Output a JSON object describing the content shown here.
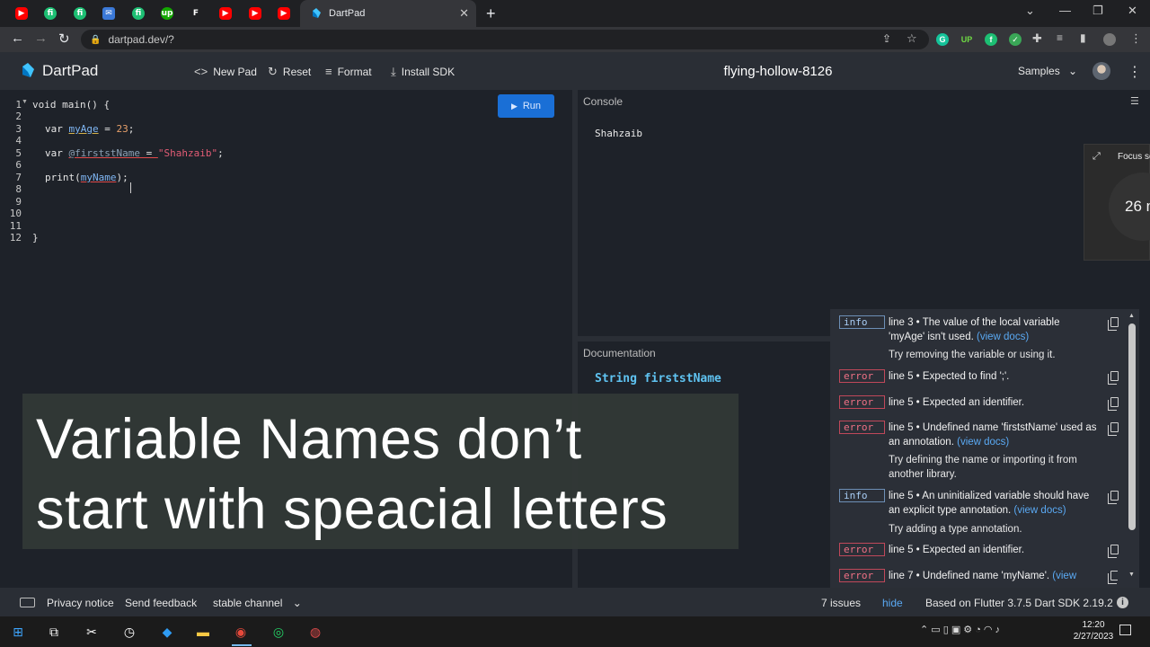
{
  "browser": {
    "active_tab_title": "DartPad",
    "url": "dartpad.dev/?",
    "pinned_tabs": [
      {
        "icon": "youtube-icon",
        "glyph": "▶"
      },
      {
        "icon": "fiverr-icon",
        "glyph": "fi"
      },
      {
        "icon": "fiverr-icon",
        "glyph": "fi"
      },
      {
        "icon": "gmail-icon",
        "glyph": "✉"
      },
      {
        "icon": "fiverr-icon",
        "glyph": "fi"
      },
      {
        "icon": "upwork-icon",
        "glyph": "up"
      },
      {
        "icon": "figma-icon",
        "glyph": "F"
      },
      {
        "icon": "youtube-icon",
        "glyph": "▶"
      },
      {
        "icon": "youtube-icon",
        "glyph": "▶"
      },
      {
        "icon": "youtube-icon",
        "glyph": "▶"
      }
    ]
  },
  "header": {
    "brand": "DartPad",
    "new_pad": "New Pad",
    "reset": "Reset",
    "format": "Format",
    "install_sdk": "Install SDK",
    "pad_name": "flying-hollow-8126",
    "samples": "Samples"
  },
  "editor": {
    "run_label": "Run",
    "line_numbers": [
      "1",
      "2",
      "3",
      "4",
      "5",
      "6",
      "7",
      "8",
      "9",
      "10",
      "11",
      "12"
    ],
    "code": {
      "l1": "void main() {",
      "l3_kw": "var",
      "l3_name": "myAge",
      "l3_eq": " = ",
      "l3_val": "23",
      "l3_end": ";",
      "l5_kw": "var",
      "l5_name": "@firststName",
      "l5_eq": " = ",
      "l5_val": "\"Shahzaib\"",
      "l5_end": ";",
      "l7_fn": "print(",
      "l7_arg": "myName",
      "l7_end": ");",
      "l12": "}"
    }
  },
  "console": {
    "title": "Console",
    "output": "Shahzaib"
  },
  "focus_widget": {
    "label": "Focus se",
    "number": "26 m"
  },
  "documentation": {
    "title": "Documentation",
    "signature": "String firststName"
  },
  "issues": [
    {
      "type": "info",
      "message": "line 3 • The value of the local variable 'myAge' isn't used.",
      "link": "(view docs)",
      "fix": "Try removing the variable or using it."
    },
    {
      "type": "error",
      "message": "line 5 • Expected to find ';'.",
      "link": "",
      "fix": ""
    },
    {
      "type": "error",
      "message": "line 5 • Expected an identifier.",
      "link": "",
      "fix": ""
    },
    {
      "type": "error",
      "message": "line 5 • Undefined name 'firststName' used as an annotation.",
      "link": "(view docs)",
      "fix": "Try defining the name or importing it from another library."
    },
    {
      "type": "info",
      "message": "line 5 • An uninitialized variable should have an explicit type annotation.",
      "link": "(view docs)",
      "fix": "Try adding a type annotation."
    },
    {
      "type": "error",
      "message": "line 5 • Expected an identifier.",
      "link": "",
      "fix": ""
    },
    {
      "type": "error",
      "message": "line 7 • Undefined name 'myName'.",
      "link": "(view",
      "fix": ""
    }
  ],
  "caption": {
    "line1": "Variable Names don’t",
    "line2": "start with speacial letters"
  },
  "footer": {
    "privacy": "Privacy notice",
    "feedback": "Send feedback",
    "channel": "stable channel",
    "issue_count": "7 issues",
    "hide": "hide",
    "sdk_info": "Based on Flutter 3.7.5 Dart SDK 2.19.2"
  },
  "taskbar": {
    "time": "12:20",
    "date": "2/27/2023"
  },
  "colors": {
    "accent": "#1a6fd6",
    "error": "#f07185",
    "info": "#a9cdf5",
    "link": "#5aa9f3"
  }
}
